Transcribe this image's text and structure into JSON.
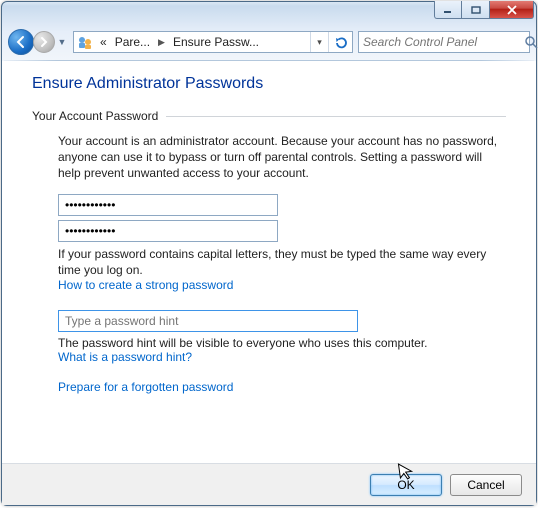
{
  "titlebar": {
    "min_tooltip": "Minimize",
    "max_tooltip": "Maximize",
    "close_tooltip": "Close"
  },
  "nav": {
    "breadcrumb_root_chevrons": "«",
    "breadcrumb_1": "Pare...",
    "breadcrumb_2": "Ensure Passw...",
    "search_placeholder": "Search Control Panel"
  },
  "page": {
    "title": "Ensure Administrator Passwords",
    "section_label": "Your Account Password",
    "description": "Your account is an administrator account. Because your account has no password, anyone can use it to bypass or turn off parental controls. Setting a password will help prevent unwanted access to your account.",
    "password_value": "************",
    "password_confirm_value": "************",
    "caps_note": "If your password contains capital letters, they must be typed the same way every time you log on.",
    "strong_link": "How to create a strong password",
    "hint_placeholder": "Type a password hint",
    "hint_note": "The password hint will be visible to everyone who uses this computer.",
    "hint_link": "What is a password hint?",
    "prepare_link": "Prepare for a forgotten password"
  },
  "footer": {
    "ok_label": "OK",
    "cancel_label": "Cancel"
  }
}
